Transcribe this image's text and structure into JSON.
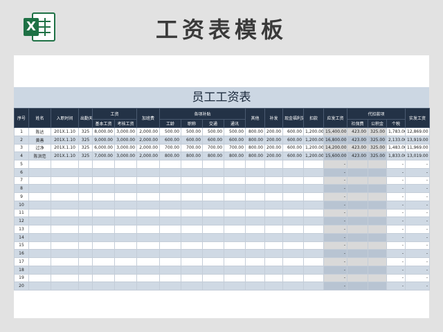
{
  "banner": {
    "title": "工资表模板"
  },
  "sheet": {
    "title": "员工工资表",
    "headers": {
      "seq": "序号",
      "name": "姓名",
      "hire_date": "入职时间",
      "days": "出勤天数",
      "salary": "工资",
      "base": "基本工资",
      "assess": "考核工资",
      "overtime": "加班费",
      "allowance": "各项补贴",
      "seniority": "工龄",
      "title": "职称",
      "traffic": "交通",
      "comm": "通讯",
      "other": "其他",
      "supplement": "补发",
      "cash_reward": "现金福利奖金",
      "deduct": "扣款",
      "payable": "应发工资",
      "withhold": "代扣款项",
      "social": "社保费",
      "fund": "公积金",
      "tax": "个税",
      "net": "实发工资"
    },
    "rows": [
      {
        "seq": "1",
        "name": "陈达",
        "date": "201X.1.10",
        "days": "325",
        "base": "8,000.00",
        "assess": "3,000.00",
        "ot": "2,000.00",
        "sen": "500.00",
        "tit": "500.00",
        "tra": "500.00",
        "com": "500.00",
        "oth": "800.00",
        "sup": "200.00",
        "cash": "600.00",
        "ded": "1,200.00",
        "pay": "15,400.00",
        "soc": "423.00",
        "fund": "325.00",
        "tax": "1,783.00",
        "net": "12,869.00"
      },
      {
        "seq": "2",
        "name": "黄善",
        "date": "201X.1.10",
        "days": "325",
        "base": "9,000.00",
        "assess": "3,000.00",
        "ot": "2,000.00",
        "sen": "600.00",
        "tit": "600.00",
        "tra": "600.00",
        "com": "600.00",
        "oth": "800.00",
        "sup": "200.00",
        "cash": "600.00",
        "ded": "1,200.00",
        "pay": "16,800.00",
        "soc": "423.00",
        "fund": "325.00",
        "tax": "2,133.00",
        "net": "13,919.00"
      },
      {
        "seq": "3",
        "name": "过净",
        "date": "201X.1.10",
        "days": "325",
        "base": "6,000.00",
        "assess": "3,000.00",
        "ot": "2,000.00",
        "sen": "700.00",
        "tit": "700.00",
        "tra": "700.00",
        "com": "700.00",
        "oth": "800.00",
        "sup": "200.00",
        "cash": "600.00",
        "ded": "1,200.00",
        "pay": "14,200.00",
        "soc": "423.00",
        "fund": "325.00",
        "tax": "1,483.00",
        "net": "11,969.00"
      },
      {
        "seq": "4",
        "name": "陈洪范",
        "date": "201X.1.10",
        "days": "325",
        "base": "7,000.00",
        "assess": "3,000.00",
        "ot": "2,000.00",
        "sen": "800.00",
        "tit": "800.00",
        "tra": "800.00",
        "com": "800.00",
        "oth": "800.00",
        "sup": "200.00",
        "cash": "600.00",
        "ded": "1,200.00",
        "pay": "15,600.00",
        "soc": "423.00",
        "fund": "325.00",
        "tax": "1,833.00",
        "net": "13,019.00"
      },
      {
        "seq": "5"
      },
      {
        "seq": "6"
      },
      {
        "seq": "7"
      },
      {
        "seq": "8"
      },
      {
        "seq": "9"
      },
      {
        "seq": "10"
      },
      {
        "seq": "11"
      },
      {
        "seq": "12"
      },
      {
        "seq": "13"
      },
      {
        "seq": "14"
      },
      {
        "seq": "15"
      },
      {
        "seq": "16"
      },
      {
        "seq": "17"
      },
      {
        "seq": "18"
      },
      {
        "seq": "19"
      },
      {
        "seq": "20"
      }
    ],
    "empty_placeholder": "-"
  }
}
